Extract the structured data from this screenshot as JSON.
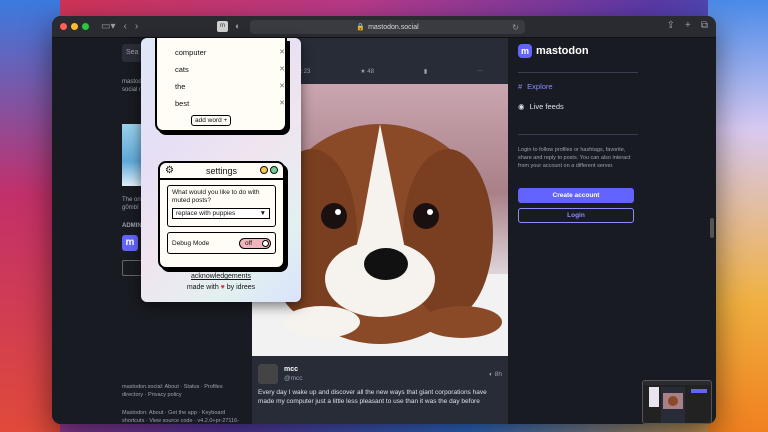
{
  "browser": {
    "url": "mastodon.social",
    "ext_icon_label": "m"
  },
  "left": {
    "search_placeholder": "Sea",
    "about_lines": [
      "mastod",
      "social r"
    ],
    "promo_lines": [
      "The orig",
      "g0mbî"
    ],
    "admin_label": "ADMIN"
  },
  "post_top": {
    "boosts": "23",
    "favs": "48"
  },
  "post": {
    "name": "mcc",
    "handle": "@mcc",
    "time": "8h",
    "text": "Every day I wake up and discover all the new ways that giant corporations have made my computer just a little less pleasant to use than it was the day before"
  },
  "right": {
    "brand": "mastodon",
    "explore": "Explore",
    "live_feeds": "Live feeds",
    "login_info": "Login to follow profiles or hashtags, favorite, share and reply to posts. You can also interact from your account on a different server.",
    "create_account": "Create account",
    "login": "Login"
  },
  "footer": {
    "line1": "mastodon.social: About · Status · Profiles directory · Privacy policy",
    "line2": "Mastodon: About · Get the app · Keyboard shortcuts · View source code · v4.2.0+pr-27116-50c1f46"
  },
  "popup": {
    "words": [
      "computer",
      "cats",
      "the",
      "best"
    ],
    "add_word": "add word +",
    "settings_title": "settings",
    "question": "What would you like to do with muted posts?",
    "selected_option": "replace with puppies",
    "debug_label": "Debug Mode",
    "debug_state": "off",
    "acknowledgements": "acknowledgements",
    "made_with_prefix": "made with",
    "made_with_suffix": "by idrees",
    "circle_colors": [
      "#f2c94c",
      "#6fcf97"
    ]
  },
  "colors": {
    "accent": "#6364ff",
    "toggle_off": "#f2b4bc"
  }
}
